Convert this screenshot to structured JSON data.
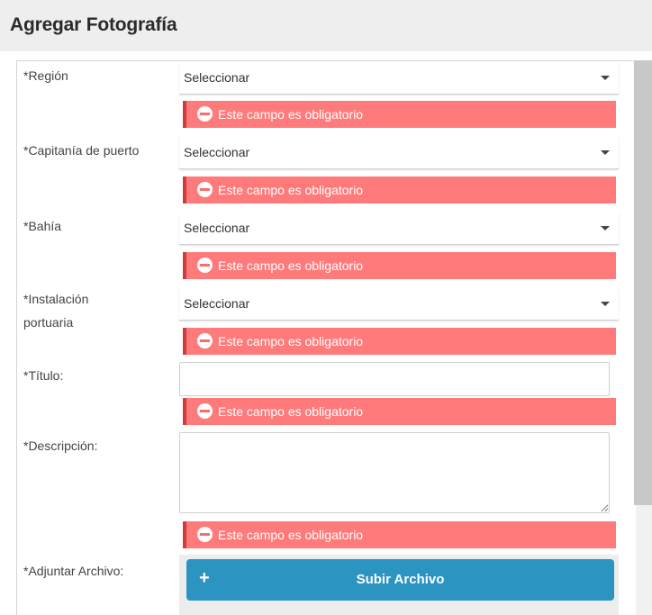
{
  "header": {
    "title": "Agregar Fotografía"
  },
  "form": {
    "region": {
      "label": "*Región",
      "value": "Seleccionar"
    },
    "capitania": {
      "label": "*Capitanía de puerto",
      "value": "Seleccionar"
    },
    "bahia": {
      "label": "*Bahía",
      "value": "Seleccionar"
    },
    "instalacion": {
      "label_line1": "*Instalación",
      "label_line2": "portuaria",
      "value": "Seleccionar"
    },
    "titulo": {
      "label": "*Título:",
      "value": ""
    },
    "descripcion": {
      "label": "*Descripción:",
      "value": ""
    },
    "adjuntar": {
      "label": "*Adjuntar Archivo:",
      "button_label": "Subir Archivo"
    },
    "error_message": "Este campo es obligatorio"
  },
  "icons": {
    "dropdown": "caret-down-icon",
    "error": "minus-circle-icon",
    "upload": "plus-icon"
  },
  "colors": {
    "error_bg": "#ff7a7a",
    "error_border": "#d33a3a",
    "button_bg": "#2b94c1",
    "header_bg": "#eeeeee"
  }
}
